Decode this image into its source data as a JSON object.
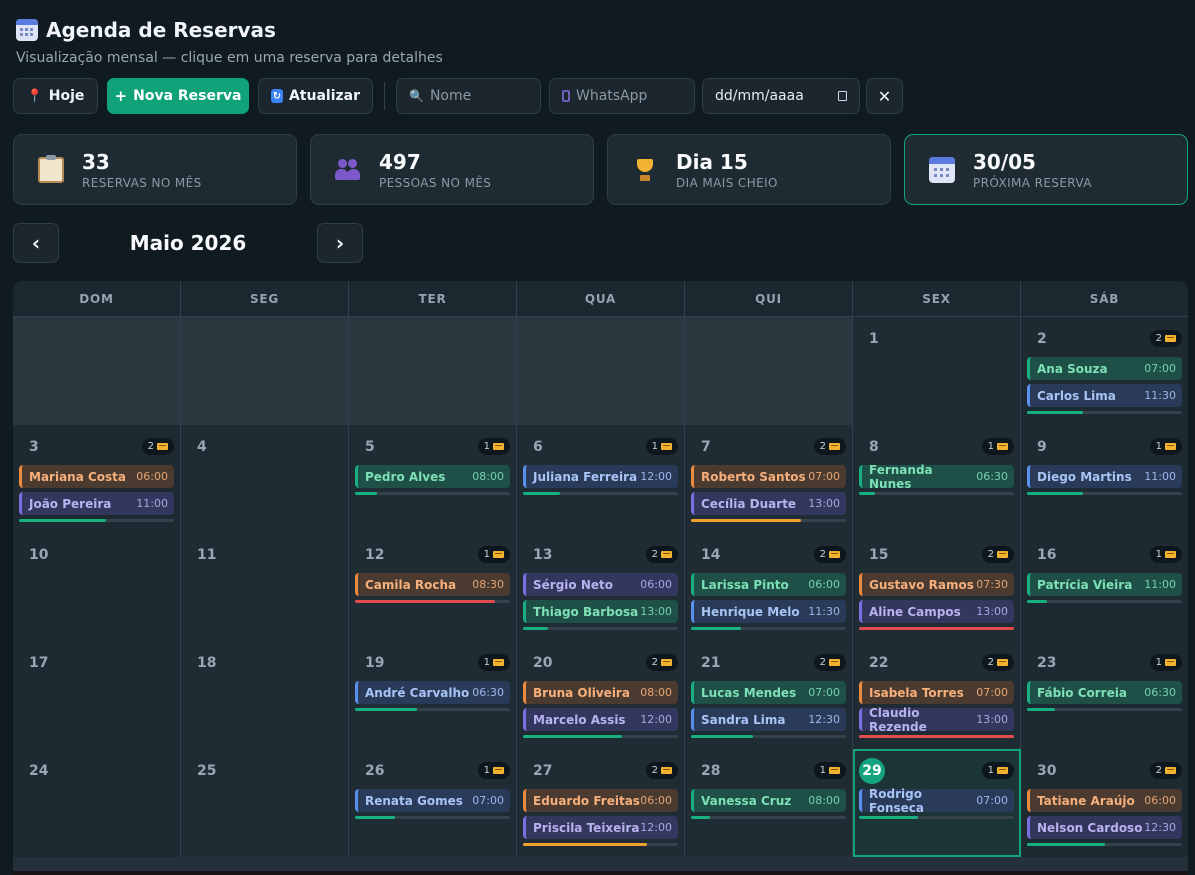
{
  "header": {
    "title": "Agenda de Reservas",
    "subtitle": "Visualização mensal — clique em uma reserva para detalhes"
  },
  "toolbar": {
    "today_label": "Hoje",
    "new_label": "Nova Reserva",
    "refresh_label": "Atualizar",
    "name_placeholder": "Nome",
    "whatsapp_placeholder": "WhatsApp",
    "date_placeholder": "dd/mm/aaaa",
    "clear_label": "✕"
  },
  "stats": [
    {
      "value": "33",
      "label": "RESERVAS NO MÊS",
      "icon": "clipboard-icon"
    },
    {
      "value": "497",
      "label": "PESSOAS NO MÊS",
      "icon": "people-icon"
    },
    {
      "value": "Dia 15",
      "label": "DIA MAIS CHEIO",
      "icon": "trophy-icon"
    },
    {
      "value": "30/05",
      "label": "PRÓXIMA RESERVA",
      "icon": "calendar-icon"
    }
  ],
  "nav": {
    "prev": "‹",
    "next": "›",
    "month_title": "Maio 2026"
  },
  "weekdays": [
    "DOM",
    "SEG",
    "TER",
    "QUA",
    "QUI",
    "SEX",
    "SÁB"
  ],
  "colors": {
    "accent": "#14a37f",
    "green": "#18b07f",
    "orange": "#f08a3c",
    "blue": "#5b8ff0",
    "purple": "#7a6ee0",
    "red": "#e24c4c"
  },
  "today": 29,
  "weeks": [
    [
      null,
      null,
      null,
      null,
      null,
      {
        "day": 1,
        "count": null,
        "events": [],
        "progress": null
      },
      {
        "day": 2,
        "count": "2",
        "events": [
          {
            "name": "Ana Souza",
            "time": "07:00",
            "color": "green"
          },
          {
            "name": "Carlos Lima",
            "time": "11:30",
            "color": "blue"
          }
        ],
        "progress": {
          "value": 0.36,
          "color": "green"
        }
      }
    ],
    [
      {
        "day": 3,
        "count": "2",
        "events": [
          {
            "name": "Mariana Costa",
            "time": "06:00",
            "color": "orange"
          },
          {
            "name": "João Pereira",
            "time": "11:00",
            "color": "purple"
          }
        ],
        "progress": {
          "value": 0.56,
          "color": "green"
        }
      },
      {
        "day": 4,
        "count": null,
        "events": [],
        "progress": null
      },
      {
        "day": 5,
        "count": "1",
        "events": [
          {
            "name": "Pedro Alves",
            "time": "08:00",
            "color": "green"
          }
        ],
        "progress": {
          "value": 0.14,
          "color": "green"
        }
      },
      {
        "day": 6,
        "count": "1",
        "events": [
          {
            "name": "Juliana Ferreira",
            "time": "12:00",
            "color": "blue"
          }
        ],
        "progress": {
          "value": 0.24,
          "color": "green"
        }
      },
      {
        "day": 7,
        "count": "2",
        "events": [
          {
            "name": "Roberto Santos",
            "time": "07:00",
            "color": "orange"
          },
          {
            "name": "Cecília Duarte",
            "time": "13:00",
            "color": "purple"
          }
        ],
        "progress": {
          "value": 0.71,
          "color": "orange"
        }
      },
      {
        "day": 8,
        "count": "1",
        "events": [
          {
            "name": "Fernanda Nunes",
            "time": "06:30",
            "color": "green"
          }
        ],
        "progress": {
          "value": 0.1,
          "color": "green"
        }
      },
      {
        "day": 9,
        "count": "1",
        "events": [
          {
            "name": "Diego Martins",
            "time": "11:00",
            "color": "blue"
          }
        ],
        "progress": {
          "value": 0.36,
          "color": "green"
        }
      }
    ],
    [
      {
        "day": 10,
        "count": null,
        "events": [],
        "progress": null
      },
      {
        "day": 11,
        "count": null,
        "events": [],
        "progress": null
      },
      {
        "day": 12,
        "count": "1",
        "events": [
          {
            "name": "Camila Rocha",
            "time": "08:30",
            "color": "orange"
          }
        ],
        "progress": {
          "value": 0.9,
          "color": "red"
        }
      },
      {
        "day": 13,
        "count": "2",
        "events": [
          {
            "name": "Sérgio Neto",
            "time": "06:00",
            "color": "purple"
          },
          {
            "name": "Thiago Barbosa",
            "time": "13:00",
            "color": "green"
          }
        ],
        "progress": {
          "value": 0.16,
          "color": "green"
        }
      },
      {
        "day": 14,
        "count": "2",
        "events": [
          {
            "name": "Larissa Pinto",
            "time": "06:00",
            "color": "green"
          },
          {
            "name": "Henrique Melo",
            "time": "11:30",
            "color": "blue"
          }
        ],
        "progress": {
          "value": 0.32,
          "color": "green"
        }
      },
      {
        "day": 15,
        "count": "2",
        "events": [
          {
            "name": "Gustavo Ramos",
            "time": "07:30",
            "color": "orange"
          },
          {
            "name": "Aline Campos",
            "time": "13:00",
            "color": "purple"
          }
        ],
        "progress": {
          "value": 1.0,
          "color": "red"
        }
      },
      {
        "day": 16,
        "count": "1",
        "events": [
          {
            "name": "Patrícia Vieira",
            "time": "11:00",
            "color": "green"
          }
        ],
        "progress": {
          "value": 0.13,
          "color": "green"
        }
      }
    ],
    [
      {
        "day": 17,
        "count": null,
        "events": [],
        "progress": null
      },
      {
        "day": 18,
        "count": null,
        "events": [],
        "progress": null
      },
      {
        "day": 19,
        "count": "1",
        "events": [
          {
            "name": "André Carvalho",
            "time": "06:30",
            "color": "blue"
          }
        ],
        "progress": {
          "value": 0.4,
          "color": "green"
        }
      },
      {
        "day": 20,
        "count": "2",
        "events": [
          {
            "name": "Bruna Oliveira",
            "time": "08:00",
            "color": "orange"
          },
          {
            "name": "Marcelo Assis",
            "time": "12:00",
            "color": "purple"
          }
        ],
        "progress": {
          "value": 0.64,
          "color": "green"
        }
      },
      {
        "day": 21,
        "count": "2",
        "events": [
          {
            "name": "Lucas Mendes",
            "time": "07:00",
            "color": "green"
          },
          {
            "name": "Sandra Lima",
            "time": "12:30",
            "color": "blue"
          }
        ],
        "progress": {
          "value": 0.4,
          "color": "green"
        }
      },
      {
        "day": 22,
        "count": "2",
        "events": [
          {
            "name": "Isabela Torres",
            "time": "07:00",
            "color": "orange"
          },
          {
            "name": "Claudio Rezende",
            "time": "13:00",
            "color": "purple"
          }
        ],
        "progress": {
          "value": 1.0,
          "color": "red"
        }
      },
      {
        "day": 23,
        "count": "1",
        "events": [
          {
            "name": "Fábio Correia",
            "time": "06:30",
            "color": "green"
          }
        ],
        "progress": {
          "value": 0.18,
          "color": "green"
        }
      }
    ],
    [
      {
        "day": 24,
        "count": null,
        "events": [],
        "progress": null
      },
      {
        "day": 25,
        "count": null,
        "events": [],
        "progress": null
      },
      {
        "day": 26,
        "count": "1",
        "events": [
          {
            "name": "Renata Gomes",
            "time": "07:00",
            "color": "blue"
          }
        ],
        "progress": {
          "value": 0.26,
          "color": "green"
        }
      },
      {
        "day": 27,
        "count": "2",
        "events": [
          {
            "name": "Eduardo Freitas",
            "time": "06:00",
            "color": "orange"
          },
          {
            "name": "Priscila Teixeira",
            "time": "12:00",
            "color": "purple"
          }
        ],
        "progress": {
          "value": 0.8,
          "color": "orange"
        }
      },
      {
        "day": 28,
        "count": "1",
        "events": [
          {
            "name": "Vanessa Cruz",
            "time": "08:00",
            "color": "green"
          }
        ],
        "progress": {
          "value": 0.12,
          "color": "green"
        }
      },
      {
        "day": 29,
        "count": "1",
        "events": [
          {
            "name": "Rodrigo Fonseca",
            "time": "07:00",
            "color": "blue"
          }
        ],
        "progress": {
          "value": 0.38,
          "color": "green"
        }
      },
      {
        "day": 30,
        "count": "2",
        "events": [
          {
            "name": "Tatiane Araújo",
            "time": "06:00",
            "color": "orange"
          },
          {
            "name": "Nelson Cardoso",
            "time": "12:30",
            "color": "purple"
          }
        ],
        "progress": {
          "value": 0.5,
          "color": "green"
        }
      }
    ]
  ]
}
